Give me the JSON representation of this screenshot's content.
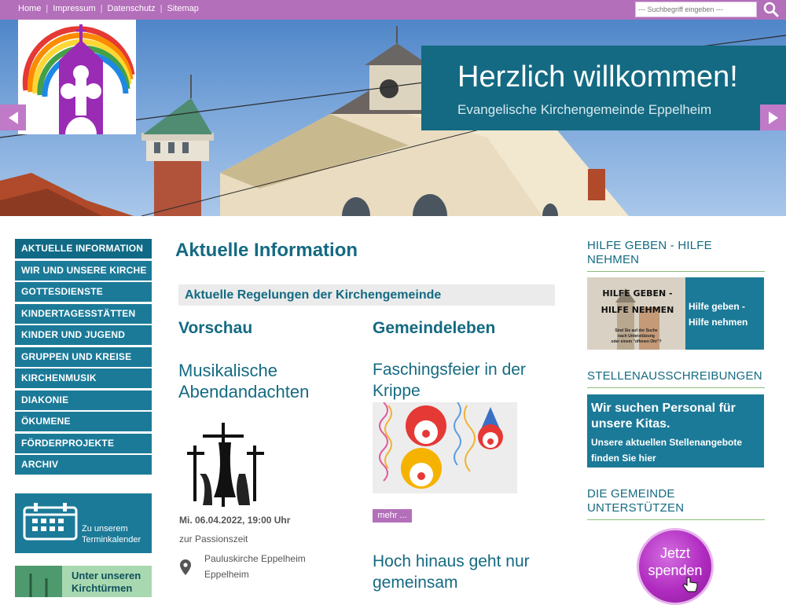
{
  "topnav": {
    "items": [
      "Home",
      "Impressum",
      "Datenschutz",
      "Sitemap"
    ],
    "separator": "|"
  },
  "search": {
    "placeholder": "--- Suchbegriff eingeben ---"
  },
  "hero": {
    "title": "Herzlich willkommen!",
    "subtitle": "Evangelische Kirchengemeinde Eppelheim"
  },
  "sidebar": {
    "items": [
      "AKTUELLE INFORMATION",
      "WIR UND UNSERE KIRCHE",
      "GOTTESDIENSTE",
      "KINDERTAGESSTÄTTEN",
      "KINDER UND JUGEND",
      "GRUPPEN UND KREISE",
      "KIRCHENMUSIK",
      "DIAKONIE",
      "ÖKUMENE",
      "FÖRDERPROJEKTE",
      "ARCHIV"
    ],
    "calendar_line1": "Zu unserem",
    "calendar_line2": "Terminkalender",
    "kirch_line1": "Unter unseren",
    "kirch_line2": "Kirchtürmen"
  },
  "main": {
    "title": "Aktuelle Information",
    "banner": "Aktuelle Regelungen der Kirchengemeinde",
    "col1_head": "Vorschau",
    "col2_head": "Gemeindeleben",
    "article1": {
      "title_line1": "Musikalische",
      "title_line2": "Abendandachten",
      "date": "Mi. 06.04.2022, 19:00 Uhr",
      "subtitle": "zur Passionszeit",
      "location1": "Pauluskirche Eppelheim",
      "location2": "Eppelheim"
    },
    "article2": {
      "title_line1": "Faschingsfeier in der",
      "title_line2": "Krippe",
      "more": "mehr ..."
    },
    "article3": {
      "title_line1": "Hoch hinaus geht nur",
      "title_line2": "gemeinsam"
    }
  },
  "right": {
    "hilfe_head_line1": "HILFE GEBEN - HILFE",
    "hilfe_head_line2": "NEHMEN",
    "hilfe_img_line1": "HILFE GEBEN -",
    "hilfe_img_line2": "HILFE NEHMEN",
    "hilfe_img_small1": "Sind Sie auf der Suche",
    "hilfe_img_small2": "nach Unterstützung",
    "hilfe_img_small3": "oder einem \"offenen Ohr\"?",
    "hilfe_link_line1": "Hilfe geben -",
    "hilfe_link_line2": "Hilfe nehmen",
    "stellen_head": "STELLENAUSSCHREIBUNGEN",
    "stellen_title_line1": "Wir suchen Personal für",
    "stellen_title_line2": "unsere Kitas.",
    "stellen_text_line1": "Unsere aktuellen Stellenangebote",
    "stellen_text_line2": "finden Sie hier",
    "support_head_line1": "DIE GEMEINDE",
    "support_head_line2": "UNTERSTÜTZEN",
    "spenden_line1": "Jetzt",
    "spenden_line2": "spenden"
  },
  "colors": {
    "topbar": "#b36fba",
    "primary": "#146a82",
    "nav": "#1b7a98",
    "accent_green": "#8cc07a"
  }
}
